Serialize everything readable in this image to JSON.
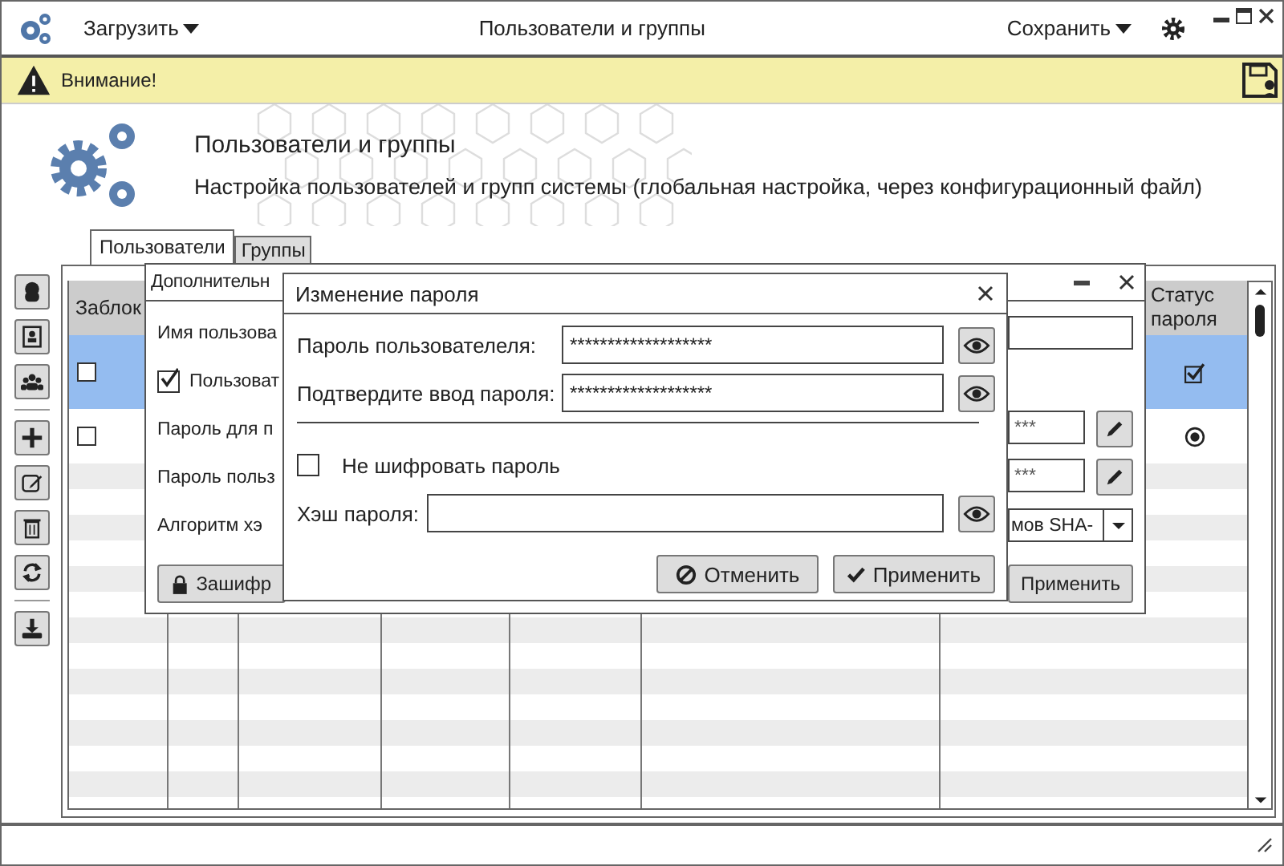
{
  "window": {
    "title": "Пользователи и группы",
    "load_menu": "Загрузить",
    "save_menu": "Сохранить"
  },
  "warning": {
    "text": "Внимание!"
  },
  "header": {
    "title": "Пользователи и группы",
    "subtitle": "Настройка пользователей и групп системы (глобальная настройка, через конфигурационный файл)"
  },
  "tabs": [
    {
      "label": "Пользователи",
      "selected": true
    },
    {
      "label": "Группы",
      "selected": false
    }
  ],
  "table": {
    "columns": [
      "Заблок",
      "Статус пароля"
    ],
    "rows": [
      {
        "selected": true,
        "blocked": false,
        "password_status": {
          "kind": "checkbox",
          "checked": true
        }
      },
      {
        "selected": false,
        "blocked": false,
        "password_status": {
          "kind": "radio",
          "checked": true
        }
      }
    ]
  },
  "settings_dialog": {
    "title": "Дополнительн",
    "fields": [
      {
        "kind": "text",
        "label": "Имя пользова"
      },
      {
        "kind": "checkbox",
        "label": "Пользоват",
        "checked": true
      },
      {
        "kind": "masked",
        "label": "Пароль для п",
        "value": "***"
      },
      {
        "kind": "masked",
        "label": "Пароль польз",
        "value": "***"
      },
      {
        "kind": "select",
        "label": "Алгоритм хэ",
        "value": "мов SHA-"
      }
    ],
    "encrypt_button": "Зашифр",
    "apply_button": "Применить"
  },
  "password_dialog": {
    "title": "Изменение пароля",
    "fields": [
      {
        "kind": "password",
        "label": "Пароль пользователеля:",
        "value": "*******************"
      },
      {
        "kind": "password",
        "label": "Подтвердите ввод пароля:",
        "value": "*******************"
      },
      {
        "kind": "checkbox",
        "label": "Не шифровать пароль",
        "checked": false
      },
      {
        "kind": "hash",
        "label": "Хэш пароля:"
      }
    ],
    "buttons": [
      {
        "kind": "cancel",
        "label": "Отменить"
      },
      {
        "kind": "apply",
        "label": "Применить"
      }
    ]
  }
}
